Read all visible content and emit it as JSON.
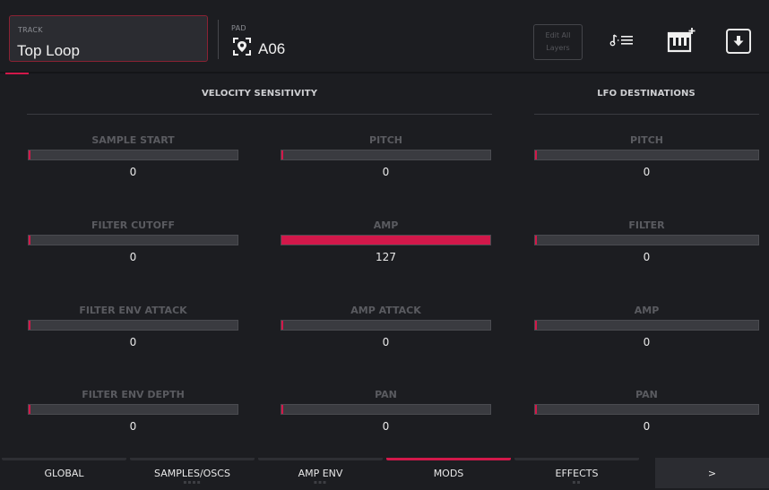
{
  "header": {
    "track_label": "TRACK",
    "track_value": "Top Loop",
    "pad_label": "PAD",
    "pad_value": "A06",
    "edit_all_layers": "Edit All Layers",
    "icons": [
      "map-pin-icon",
      "note-list-icon",
      "piano-plus-icon",
      "download-icon"
    ]
  },
  "velocity": {
    "title": "VELOCITY SENSITIVITY",
    "params": [
      {
        "label": "SAMPLE START",
        "value": "0",
        "level": 0
      },
      {
        "label": "PITCH",
        "value": "0",
        "level": 0
      },
      {
        "label": "FILTER CUTOFF",
        "value": "0",
        "level": 0
      },
      {
        "label": "AMP",
        "value": "127",
        "level": 1.0
      },
      {
        "label": "FILTER ENV ATTACK",
        "value": "0",
        "level": 0
      },
      {
        "label": "AMP ATTACK",
        "value": "0",
        "level": 0
      },
      {
        "label": "FILTER ENV DEPTH",
        "value": "0",
        "level": 0
      },
      {
        "label": "PAN",
        "value": "0",
        "level": 0
      }
    ]
  },
  "lfo": {
    "title": "LFO DESTINATIONS",
    "params": [
      {
        "label": "PITCH",
        "value": "0",
        "level": 0
      },
      {
        "label": "FILTER",
        "value": "0",
        "level": 0
      },
      {
        "label": "AMP",
        "value": "0",
        "level": 0
      },
      {
        "label": "PAN",
        "value": "0",
        "level": 0
      }
    ]
  },
  "tabs": [
    {
      "label": "GLOBAL",
      "active": false,
      "dots": ""
    },
    {
      "label": "SAMPLES/OSCS",
      "active": false,
      "dots": "▪▪▪▪"
    },
    {
      "label": "AMP ENV",
      "active": false,
      "dots": "▪▪▪"
    },
    {
      "label": "MODS",
      "active": true,
      "dots": ""
    },
    {
      "label": "EFFECTS",
      "active": false,
      "dots": "▪▪"
    },
    {
      "label": ">",
      "active": false,
      "dots": ""
    }
  ],
  "colors": {
    "accent": "#d2184a",
    "background": "#1c1d21",
    "bar": "#3a3b40"
  }
}
